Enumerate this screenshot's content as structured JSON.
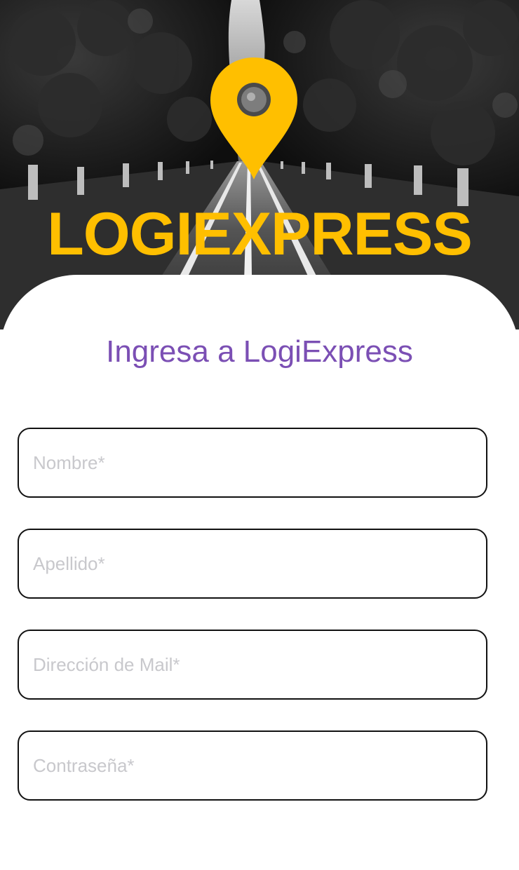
{
  "app": {
    "brand_name": "LOGIEXPRESS",
    "brand_color": "#FFBF00"
  },
  "hero": {
    "background_description": "black-and-white tree-lined road",
    "pin_icon": "map-pin-icon",
    "pin_color": "#FFBF00"
  },
  "login": {
    "title": "Ingresa a LogiExpress",
    "title_color": "#7B4FB4",
    "fields": [
      {
        "name": "nombre",
        "placeholder": "Nombre*",
        "value": ""
      },
      {
        "name": "apellido",
        "placeholder": "Apellido*",
        "value": ""
      },
      {
        "name": "mail",
        "placeholder": "Dirección de Mail*",
        "value": ""
      },
      {
        "name": "contrasena",
        "placeholder": "Contraseña*",
        "value": ""
      }
    ]
  }
}
